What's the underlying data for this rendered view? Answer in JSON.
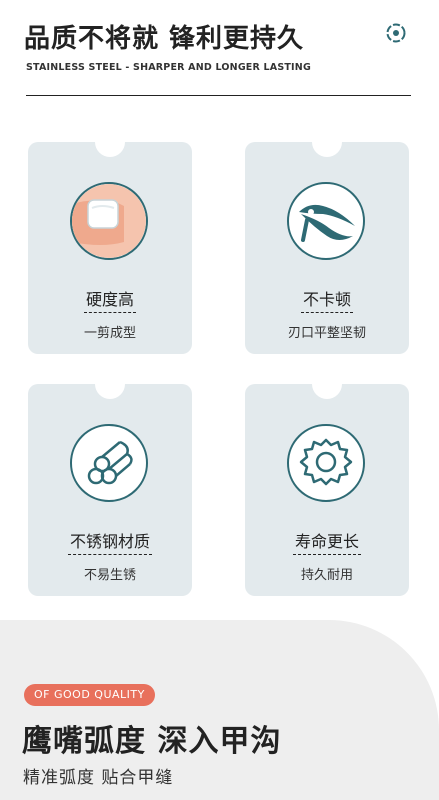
{
  "header": {
    "title": "品质不将就 锋利更持久",
    "subtitle": "STAINLESS STEEL - SHARPER AND LONGER LASTING",
    "icon": "settings-dot-icon"
  },
  "features": [
    {
      "label": "硬度高",
      "desc": "一剪成型",
      "icon": "nail-icon"
    },
    {
      "label": "不卡顿",
      "desc": "刃口平整坚韧",
      "icon": "clipper-icon"
    },
    {
      "label": "不锈钢材质",
      "desc": "不易生锈",
      "icon": "steel-rods-icon"
    },
    {
      "label": "寿命更长",
      "desc": "持久耐用",
      "icon": "gear-icon"
    }
  ],
  "promo": {
    "badge": "OF GOOD QUALITY",
    "headline": "鹰嘴弧度 深入甲沟",
    "subline": "精准弧度 贴合甲缝"
  },
  "colors": {
    "card_bg": "#e3eaed",
    "icon_teal": "#2e6a74",
    "badge": "#e8705c"
  }
}
